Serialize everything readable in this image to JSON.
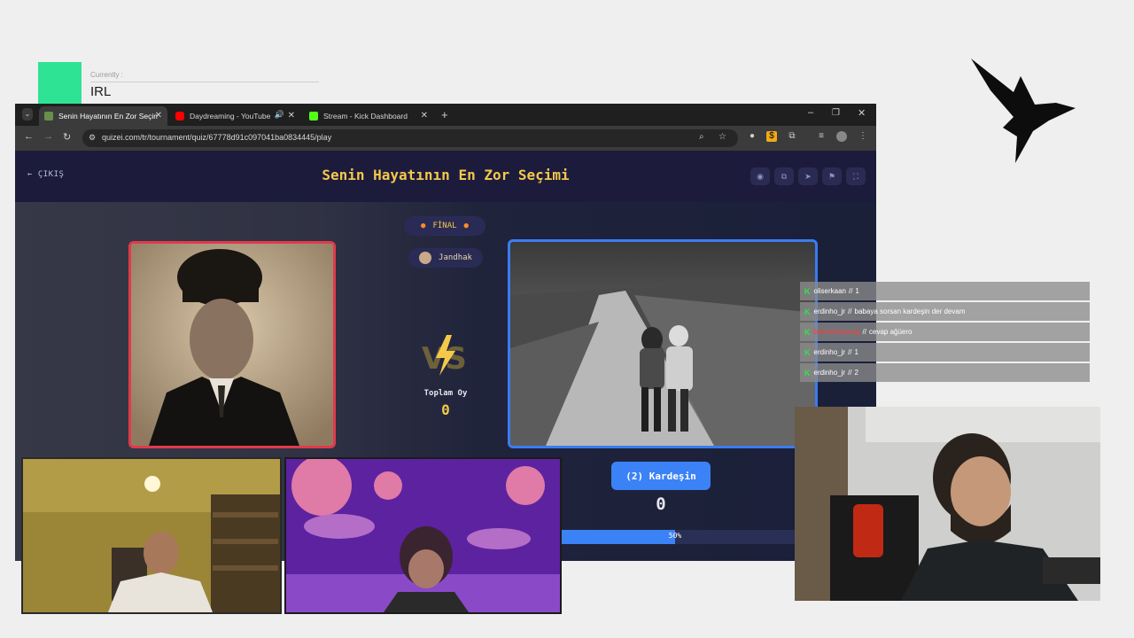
{
  "overlay": {
    "currently_label": "Currently :",
    "currently_value": "IRL",
    "accent_color": "#2fe394",
    "logo_icon": "bird-logo-icon"
  },
  "browser": {
    "tabs": [
      {
        "title": "Senin Hayatının En Zor Seçimi",
        "active": true,
        "icon": "quizei-favicon-icon"
      },
      {
        "title": "Daydreaming - YouTube",
        "active": false,
        "icon": "youtube-favicon-icon"
      },
      {
        "title": "Stream - Kick Dashboard",
        "active": false,
        "icon": "kick-favicon-icon"
      }
    ],
    "url": "quizei.com/tr/tournament/quiz/67778d91c097041ba0834445/play"
  },
  "page": {
    "back_label": "ÇIKIŞ",
    "title": "Senin Hayatının En Zor Seçimi",
    "round_label": "FİNAL",
    "creator_name": "Jandhak",
    "total_votes_label": "Toplam Oy",
    "total_votes_value": "0",
    "right_choice_label": "(2) Kardeşin",
    "right_choice_votes": "0",
    "right_choice_percent_label": "50%",
    "right_choice_percent": 50,
    "colors": {
      "title": "#f4c84a",
      "left_border": "#e03a4a",
      "right_border": "#3a7cf0",
      "button": "#3b82f6"
    }
  },
  "chat": [
    {
      "user": "oliserkaan",
      "message": "1",
      "user_color": "#ffffff"
    },
    {
      "user": "erdinho_jr",
      "message": "babaya sorsan kardeşin der devam",
      "user_color": "#ffffff"
    },
    {
      "user": "baronickyoung",
      "message": "cevap ağüero",
      "user_color": "#ff3b3b"
    },
    {
      "user": "erdinho_jr",
      "message": "1",
      "user_color": "#ffffff"
    },
    {
      "user": "erdinho_jr",
      "message": "2",
      "user_color": "#ffffff"
    }
  ]
}
